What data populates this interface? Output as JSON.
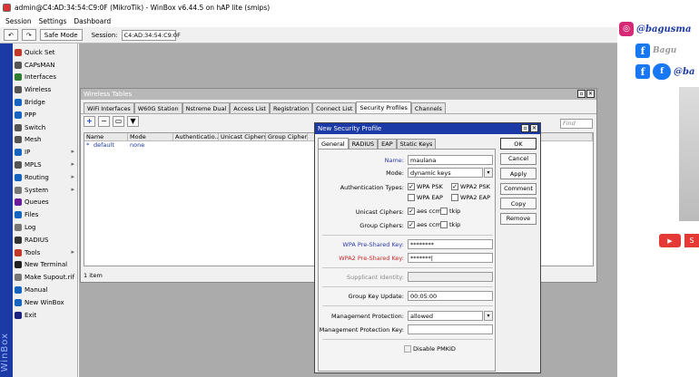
{
  "window": {
    "title": "admin@C4:AD:34:54:C9:0F (MikroTik) - WinBox v6.44.5 on hAP lite (smips)",
    "menu": [
      "Session",
      "Settings",
      "Dashboard"
    ],
    "safe_mode_label": "Safe Mode",
    "session_label": "Session:",
    "session_value": "C4:AD:34:54:C9:0F",
    "undo_icon": "undo-icon",
    "redo_icon": "redo-icon"
  },
  "sidebar": {
    "brand": "WinBox",
    "items": [
      {
        "label": "Quick Set",
        "icon": "quick-set-icon",
        "color": "#c0392b",
        "submenu": false
      },
      {
        "label": "CAPsMAN",
        "icon": "capsman-icon",
        "color": "#555555",
        "submenu": false
      },
      {
        "label": "Interfaces",
        "icon": "interfaces-icon",
        "color": "#2e7d32",
        "submenu": false
      },
      {
        "label": "Wireless",
        "icon": "wireless-icon",
        "color": "#555555",
        "submenu": false
      },
      {
        "label": "Bridge",
        "icon": "bridge-icon",
        "color": "#1565c0",
        "submenu": false
      },
      {
        "label": "PPP",
        "icon": "ppp-icon",
        "color": "#1565c0",
        "submenu": false
      },
      {
        "label": "Switch",
        "icon": "switch-icon",
        "color": "#555555",
        "submenu": false
      },
      {
        "label": "Mesh",
        "icon": "mesh-icon",
        "color": "#555555",
        "submenu": false
      },
      {
        "label": "IP",
        "icon": "ip-icon",
        "color": "#1565c0",
        "submenu": true
      },
      {
        "label": "MPLS",
        "icon": "mpls-icon",
        "color": "#555555",
        "submenu": true
      },
      {
        "label": "Routing",
        "icon": "routing-icon",
        "color": "#1565c0",
        "submenu": true
      },
      {
        "label": "System",
        "icon": "system-icon",
        "color": "#777777",
        "submenu": true
      },
      {
        "label": "Queues",
        "icon": "queues-icon",
        "color": "#6a1b9a",
        "submenu": false
      },
      {
        "label": "Files",
        "icon": "files-icon",
        "color": "#1565c0",
        "submenu": false
      },
      {
        "label": "Log",
        "icon": "log-icon",
        "color": "#777777",
        "submenu": false
      },
      {
        "label": "RADIUS",
        "icon": "radius-icon",
        "color": "#333333",
        "submenu": false
      },
      {
        "label": "Tools",
        "icon": "tools-icon",
        "color": "#c0392b",
        "submenu": true
      },
      {
        "label": "New Terminal",
        "icon": "terminal-icon",
        "color": "#222222",
        "submenu": false
      },
      {
        "label": "Make Supout.rif",
        "icon": "supout-icon",
        "color": "#777777",
        "submenu": false
      },
      {
        "label": "Manual",
        "icon": "manual-icon",
        "color": "#1565c0",
        "submenu": false
      },
      {
        "label": "New WinBox",
        "icon": "new-winbox-icon",
        "color": "#1565c0",
        "submenu": false
      },
      {
        "label": "Exit",
        "icon": "exit-icon",
        "color": "#1a237e",
        "submenu": false
      }
    ]
  },
  "wireless_tables": {
    "title": "Wireless Tables",
    "tabs": [
      "WiFi Interfaces",
      "W60G Station",
      "Nstreme Dual",
      "Access List",
      "Registration",
      "Connect List",
      "Security Profiles",
      "Channels"
    ],
    "active_tab": 6,
    "find_placeholder": "Find",
    "columns": [
      "Name",
      "Mode",
      "Authenticatio...",
      "Unicast Ciphers",
      "Group Ciphers"
    ],
    "rows": [
      {
        "marker": "*",
        "name": "default",
        "mode": "none"
      }
    ],
    "status": "1 item"
  },
  "dialog": {
    "title": "New Security Profile",
    "tabs": [
      "General",
      "RADIUS",
      "EAP",
      "Static Keys"
    ],
    "active_tab": 0,
    "name_label": "Name:",
    "name_value": "maulana",
    "mode_label": "Mode:",
    "mode_value": "dynamic keys",
    "auth_label": "Authentication Types:",
    "auth_options": [
      {
        "label": "WPA PSK",
        "checked": true
      },
      {
        "label": "WPA2 PSK",
        "checked": true
      },
      {
        "label": "WPA EAP",
        "checked": false
      },
      {
        "label": "WPA2 EAP",
        "checked": false
      }
    ],
    "unicast_label": "Unicast Ciphers:",
    "unicast_options": [
      {
        "label": "aes ccm",
        "checked": true
      },
      {
        "label": "tkip",
        "checked": false
      }
    ],
    "group_label": "Group Ciphers:",
    "group_options": [
      {
        "label": "aes ccm",
        "checked": true
      },
      {
        "label": "tkip",
        "checked": false
      }
    ],
    "wpa_key_label": "WPA Pre-Shared Key:",
    "wpa_key_value": "********",
    "wpa2_key_label": "WPA2 Pre-Shared Key:",
    "wpa2_key_value": "*******|",
    "supplicant_label": "Supplicant Identity:",
    "supplicant_value": "",
    "group_update_label": "Group Key Update:",
    "group_update_value": "00:05:00",
    "mgmt_label": "Management Protection:",
    "mgmt_value": "allowed",
    "mgmt_key_label": "Management Protection Key:",
    "mgmt_key_value": "",
    "pmkid_label": "Disable PMKID",
    "pmkid_checked": false,
    "buttons": [
      "OK",
      "Cancel",
      "Apply",
      "Comment",
      "Copy",
      "Remove"
    ]
  },
  "overlay": {
    "instagram_text": "@bagusma",
    "facebook_text": "Bagu",
    "facebook2_text": "@ba",
    "facebook2_badge": "f",
    "youtube_text": "S"
  }
}
